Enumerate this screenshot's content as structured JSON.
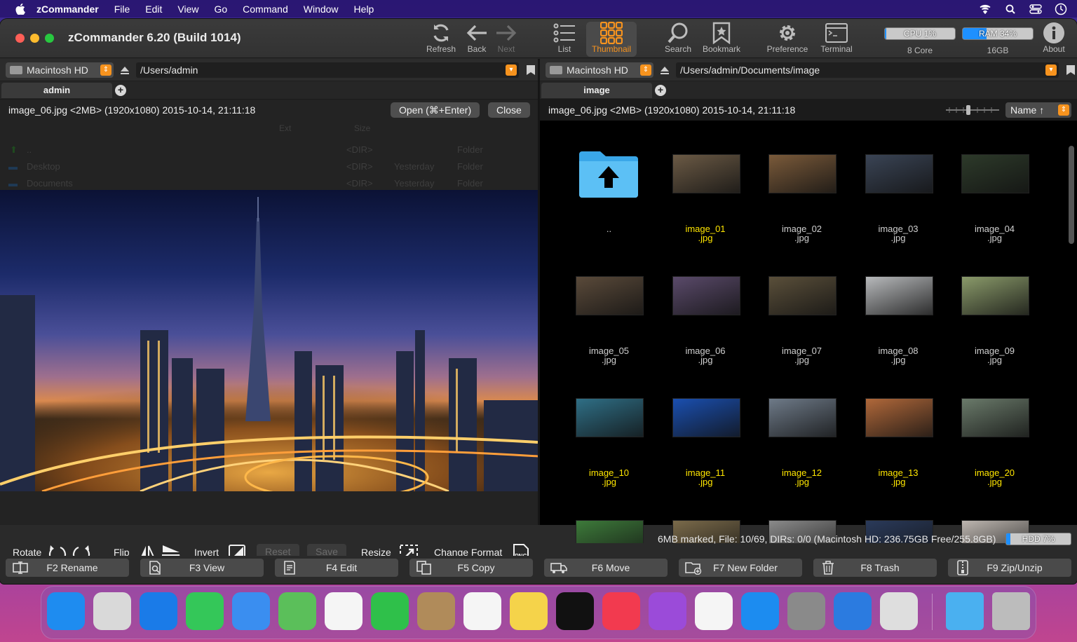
{
  "menubar": {
    "items": [
      "zCommander",
      "File",
      "Edit",
      "View",
      "Go",
      "Command",
      "Window",
      "Help"
    ]
  },
  "window": {
    "title": "zCommander 6.20 (Build 1014)"
  },
  "toolbar": {
    "refresh": "Refresh",
    "back": "Back",
    "next": "Next",
    "list": "List",
    "thumbnail": "Thumbnail",
    "search": "Search",
    "bookmark": "Bookmark",
    "preference": "Preference",
    "terminal": "Terminal",
    "about": "About",
    "cpu": {
      "label": "CPU 1%",
      "sub": "8 Core",
      "level": 0.01
    },
    "ram": {
      "label": "RAM 34%",
      "sub": "16GB",
      "level": 0.34
    }
  },
  "left": {
    "volume": "Macintosh HD",
    "path": "/Users/admin",
    "tab": "admin",
    "info": "image_06.jpg <2MB> (1920x1080) 2015-10-14, 21:11:18",
    "open_button": "Open (⌘+Enter)",
    "close_button": "Close",
    "ghost_headers": {
      "ext": "Ext",
      "size": "Size"
    },
    "ghost_rows": [
      {
        "name": "..",
        "size": "<DIR>",
        "date": "",
        "kind": "Folder"
      },
      {
        "name": "Desktop",
        "size": "<DIR>",
        "date": "Yesterday",
        "kind": "Folder"
      },
      {
        "name": "Documents",
        "size": "<DIR>",
        "date": "Yesterday",
        "kind": "Folder"
      }
    ],
    "tools": {
      "rotate": "Rotate",
      "flip": "Flip",
      "invert": "Invert",
      "reset": "Reset",
      "save": "Save",
      "resize": "Resize",
      "change_format": "Change Format",
      "png_badge": "PNG"
    }
  },
  "right": {
    "volume": "Macintosh HD",
    "path": "/Users/admin/Documents/image",
    "tab": "image",
    "info": "image_06.jpg <2MB> (1920x1080) 2015-10-14, 21:11:18",
    "sort": "Name ↑",
    "items": [
      {
        "name": "..",
        "ext": "",
        "selected": false,
        "color": "folder"
      },
      {
        "name": "image_01",
        "ext": ".jpg",
        "selected": true,
        "color": "#6b5a45"
      },
      {
        "name": "image_02",
        "ext": ".jpg",
        "selected": false,
        "color": "#7a5a3a"
      },
      {
        "name": "image_03",
        "ext": ".jpg",
        "selected": false,
        "color": "#3a4455"
      },
      {
        "name": "image_04",
        "ext": ".jpg",
        "selected": false,
        "color": "#2d3a2a"
      },
      {
        "name": "image_05",
        "ext": ".jpg",
        "selected": false,
        "color": "#5a4a3a"
      },
      {
        "name": "image_06",
        "ext": ".jpg",
        "selected": false,
        "color": "#5a4a6a"
      },
      {
        "name": "image_07",
        "ext": ".jpg",
        "selected": false,
        "color": "#5a4f3a"
      },
      {
        "name": "image_08",
        "ext": ".jpg",
        "selected": false,
        "color": "#b7b9bb"
      },
      {
        "name": "image_09",
        "ext": ".jpg",
        "selected": false,
        "color": "#8a9a6a"
      },
      {
        "name": "image_10",
        "ext": ".jpg",
        "selected": true,
        "color": "#2f6f86"
      },
      {
        "name": "image_11",
        "ext": ".jpg",
        "selected": true,
        "color": "#1a4fb0"
      },
      {
        "name": "image_12",
        "ext": ".jpg",
        "selected": true,
        "color": "#6e7a88"
      },
      {
        "name": "image_13",
        "ext": ".jpg",
        "selected": true,
        "color": "#b0683a"
      },
      {
        "name": "image_20",
        "ext": ".jpg",
        "selected": true,
        "color": "#6a7a6a"
      },
      {
        "name": "",
        "ext": "",
        "selected": false,
        "color": "#3d7a3a"
      },
      {
        "name": "",
        "ext": "",
        "selected": false,
        "color": "#7a6a4a"
      },
      {
        "name": "",
        "ext": "",
        "selected": false,
        "color": "#8a8a8a"
      },
      {
        "name": "",
        "ext": "",
        "selected": false,
        "color": "#2a3a5a"
      },
      {
        "name": "",
        "ext": "",
        "selected": false,
        "color": "#bdb6b0"
      }
    ]
  },
  "status": {
    "text": "6MB marked, File: 10/69, DIRs: 0/0  (Macintosh HD: 236.75GB Free/255.8GB)",
    "hdd": "HDD 7%",
    "hdd_level": 0.07
  },
  "fkeys": [
    {
      "label": "F2 Rename",
      "icon": "rename-icon"
    },
    {
      "label": "F3 View",
      "icon": "view-icon"
    },
    {
      "label": "F4 Edit",
      "icon": "edit-icon"
    },
    {
      "label": "F5 Copy",
      "icon": "copy-icon"
    },
    {
      "label": "F6 Move",
      "icon": "move-icon"
    },
    {
      "label": "F7 New Folder",
      "icon": "new-folder-icon"
    },
    {
      "label": "F8 Trash",
      "icon": "trash-icon"
    },
    {
      "label": "F9 Zip/Unzip",
      "icon": "zip-icon"
    }
  ],
  "dock": [
    {
      "name": "finder",
      "color": "#1e8cf0"
    },
    {
      "name": "launchpad",
      "color": "#d9d9d9"
    },
    {
      "name": "safari",
      "color": "#1a7be8"
    },
    {
      "name": "messages",
      "color": "#34c759"
    },
    {
      "name": "mail",
      "color": "#3a8ef0"
    },
    {
      "name": "maps",
      "color": "#5bbf5a"
    },
    {
      "name": "photos",
      "color": "#f5f5f5"
    },
    {
      "name": "facetime",
      "color": "#2fc04a"
    },
    {
      "name": "contacts",
      "color": "#b08b5a"
    },
    {
      "name": "reminders",
      "color": "#f5f5f5"
    },
    {
      "name": "notes",
      "color": "#f5d34a"
    },
    {
      "name": "apple-tv",
      "color": "#111111"
    },
    {
      "name": "music",
      "color": "#f23a4f"
    },
    {
      "name": "podcasts",
      "color": "#9b4bd9"
    },
    {
      "name": "news",
      "color": "#f5f5f5"
    },
    {
      "name": "app-store",
      "color": "#1c8cf0"
    },
    {
      "name": "system-preferences",
      "color": "#8a8a8a"
    },
    {
      "name": "zcommander-mountain",
      "color": "#2b7be0"
    },
    {
      "name": "zcommander-disk",
      "color": "#dedede"
    },
    {
      "name": "folder",
      "color": "#4ab0f0"
    },
    {
      "name": "trash",
      "color": "#bcbcbc"
    }
  ]
}
